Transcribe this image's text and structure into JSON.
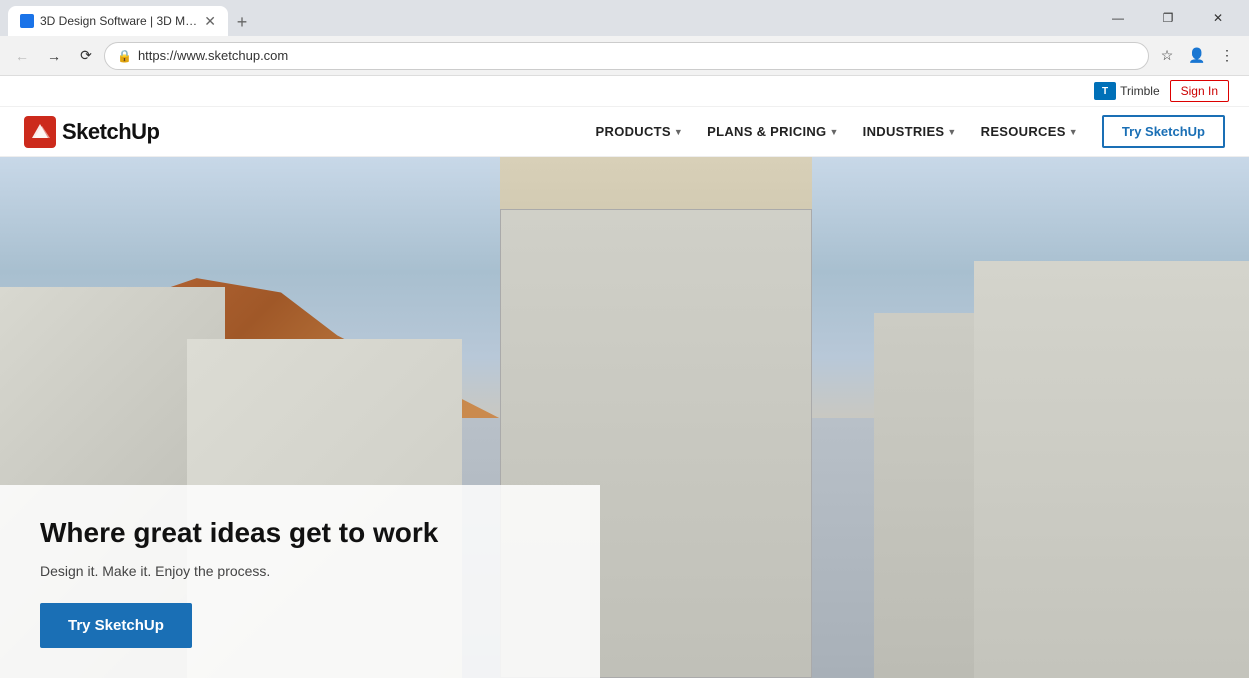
{
  "browser": {
    "tab": {
      "title": "3D Design Software | 3D Model...",
      "favicon_color": "#1a73e8"
    },
    "address": "https://www.sketchup.com",
    "controls": {
      "minimize": "—",
      "restore": "❐",
      "close": "✕"
    },
    "new_tab": "+"
  },
  "site": {
    "topbar": {
      "trimble_name": "Trimble",
      "sign_in": "Sign In"
    },
    "logo": {
      "text": "SketchUp"
    },
    "nav": {
      "items": [
        {
          "label": "PRODUCTS",
          "has_dropdown": true
        },
        {
          "label": "PLANS & PRICING",
          "has_dropdown": true
        },
        {
          "label": "INDUSTRIES",
          "has_dropdown": true
        },
        {
          "label": "RESOURCES",
          "has_dropdown": true
        }
      ],
      "cta": "Try SketchUp"
    },
    "hero": {
      "title": "Where great ideas get to work",
      "subtitle": "Design it. Make it. Enjoy the process.",
      "cta": "Try SketchUp"
    }
  }
}
